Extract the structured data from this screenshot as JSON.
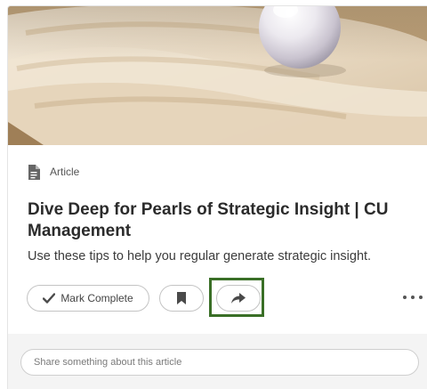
{
  "card": {
    "type_label": "Article",
    "title": "Dive Deep for Pearls of Strategic Insight | CU Management",
    "description": "Use these tips to help you regular generate strategic insight."
  },
  "actions": {
    "mark_complete_label": "Mark Complete"
  },
  "comment": {
    "placeholder": "Share something about this article"
  },
  "colors": {
    "highlight_border": "#3a6f27",
    "title_text": "#2b2b2b"
  },
  "icons": {
    "type": "document-icon",
    "complete": "checkmark-icon",
    "bookmark": "bookmark-icon",
    "share": "share-arrow-icon",
    "more": "more-dots-icon"
  }
}
